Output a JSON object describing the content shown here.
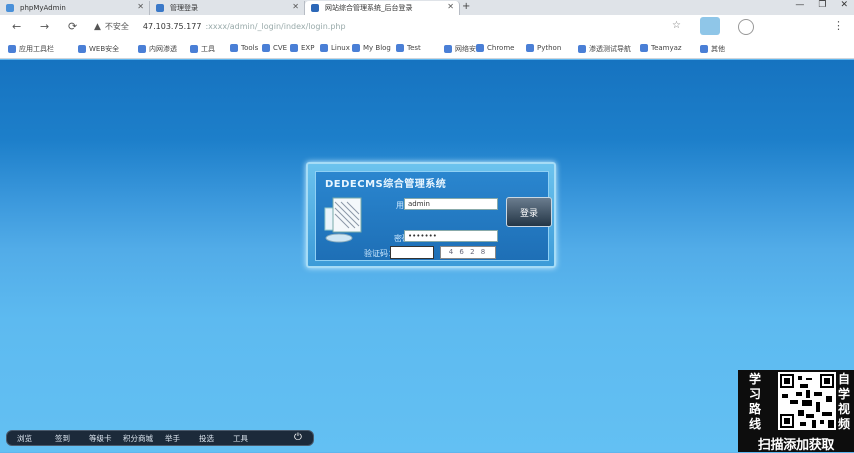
{
  "browser": {
    "tabs": [
      {
        "title": "phpMyAdmin",
        "icon_color": "#4a90d9"
      },
      {
        "title": "管理登录",
        "icon_color": "#3a78c8"
      },
      {
        "title": "网站综合管理系统_后台登录",
        "icon_color": "#2c68b8"
      }
    ],
    "new_tab_label": "+",
    "window_controls": {
      "minimize": "—",
      "maximize": "❐",
      "close": "✕"
    },
    "nav": {
      "back": "←",
      "forward": "→",
      "reload": "⟳"
    },
    "address": {
      "security_icon": "warning-icon",
      "security_text": "不安全",
      "host": "47.103.75.177",
      "path": ":xxxx/admin/_login/index/login.php"
    },
    "bookmark_star": "☆",
    "menu_glyph": "⋮",
    "bookmarks": [
      "应用工具栏",
      "WEB安全",
      "内网渗透",
      "工具",
      "Tools",
      "CVE",
      "EXP",
      "Linux",
      "My Blog",
      "Test",
      "网络安全",
      "Chrome",
      "Python",
      "渗透测试导航",
      "Teamyaz",
      "其他"
    ]
  },
  "login": {
    "title": "DEDECMS综合管理系统",
    "username_label": "用户名：",
    "username_value": "admin",
    "password_label": "密码：",
    "password_value": "•••••••",
    "captcha_label": "验证码：",
    "captcha_text": "4 6 2 8",
    "login_button": "登录"
  },
  "taskbar": {
    "items": [
      "浏览",
      "签到",
      "等级卡",
      "积分商城",
      "举手",
      "投选",
      "工具"
    ],
    "power_glyph": "⏻"
  },
  "overlay": {
    "left_chars": [
      "学",
      "习",
      "路",
      "线"
    ],
    "right_chars": [
      "自",
      "学",
      "视",
      "频"
    ],
    "caption": "扫描添加获取"
  },
  "colors": {
    "page_top": "#1673c0",
    "page_bottom": "#63c0f3",
    "login_panel": "#2a86cf",
    "taskbar": "#1c2a3a"
  }
}
